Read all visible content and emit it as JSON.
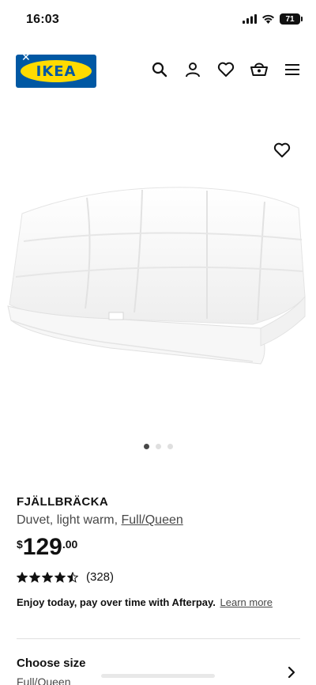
{
  "status_bar": {
    "time": "16:03",
    "battery": "71"
  },
  "header": {
    "logo_text": "IKEA",
    "icons": [
      "search-icon",
      "account-icon",
      "favourites-icon",
      "cart-icon",
      "menu-icon"
    ]
  },
  "gallery": {
    "dot_count": 3,
    "active_index": 0
  },
  "product": {
    "name": "FJÄLLBRÄCKA",
    "description": "Duvet, light warm,",
    "size_link": "Full/Queen",
    "price_currency": "$",
    "price_whole": "129",
    "price_decimal": ".00",
    "rating": 4.5,
    "review_count": "(328)"
  },
  "afterpay": {
    "text": "Enjoy today, pay over time with Afterpay.",
    "link": "Learn more"
  },
  "size_selector": {
    "label": "Choose size",
    "value": "Full/Queen"
  },
  "colors": {
    "ikea_blue": "#0058a3",
    "ikea_yellow": "#ffdb00"
  }
}
